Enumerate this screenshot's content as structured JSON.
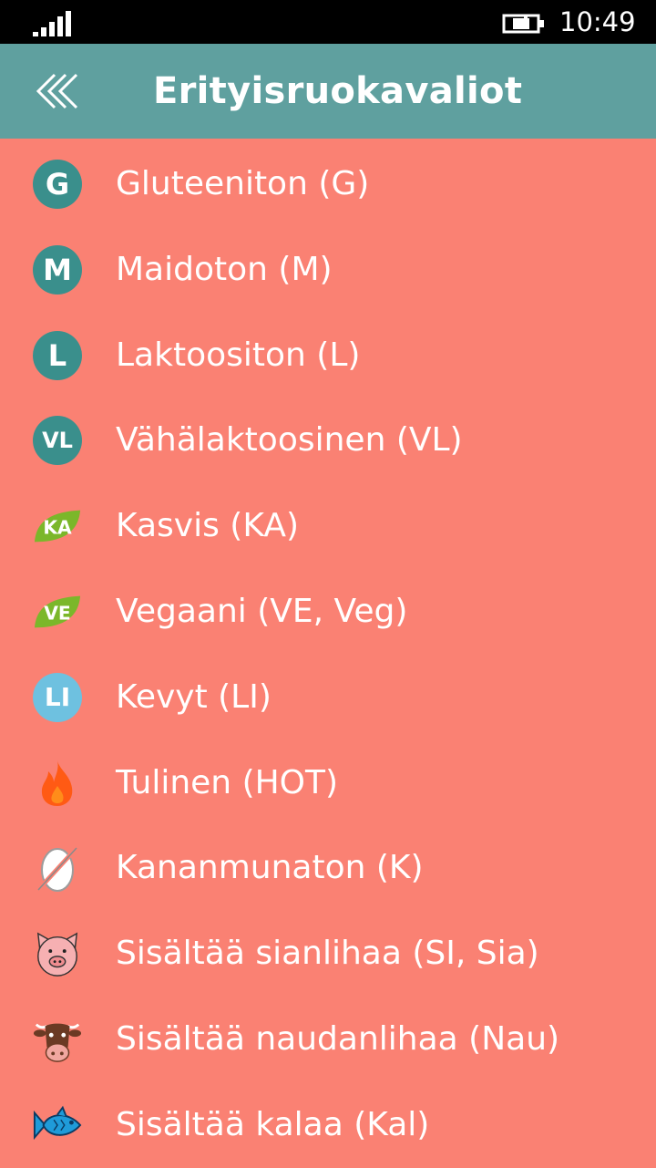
{
  "status_bar": {
    "time": "10:49",
    "signal_icon": "signal-icon",
    "battery_icon": "battery-charging-icon"
  },
  "header": {
    "title": "Erityisruokavaliot",
    "back_icon": "back-chevrons-icon"
  },
  "items": [
    {
      "label": "Gluteeniton (G)",
      "badge": "G",
      "icon": "gluten-free-icon"
    },
    {
      "label": "Maidoton (M)",
      "badge": "M",
      "icon": "dairy-free-icon"
    },
    {
      "label": "Laktoositon (L)",
      "badge": "L",
      "icon": "lactose-free-icon"
    },
    {
      "label": "Vähälaktoosinen (VL)",
      "badge": "VL",
      "icon": "low-lactose-icon"
    },
    {
      "label": "Kasvis (KA)",
      "badge": "KA",
      "icon": "vegetarian-leaf-icon"
    },
    {
      "label": "Vegaani (VE, Veg)",
      "badge": "VE",
      "icon": "vegan-leaf-icon"
    },
    {
      "label": "Kevyt (LI)",
      "badge": "LI",
      "icon": "light-icon"
    },
    {
      "label": "Tulinen (HOT)",
      "icon": "flame-icon"
    },
    {
      "label": "Kananmunaton (K)",
      "icon": "no-egg-icon"
    },
    {
      "label": "Sisältää sianlihaa (SI, Sia)",
      "icon": "pig-icon"
    },
    {
      "label": "Sisältää naudanlihaa (Nau)",
      "icon": "cow-icon"
    },
    {
      "label": "Sisältää kalaa (Kal)",
      "icon": "fish-icon"
    }
  ],
  "colors": {
    "background": "#fa8173",
    "header": "#5fa09f",
    "badge": "#3a8f8c",
    "leaf": "#7bb72a",
    "light_badge": "#6ec1e0"
  }
}
